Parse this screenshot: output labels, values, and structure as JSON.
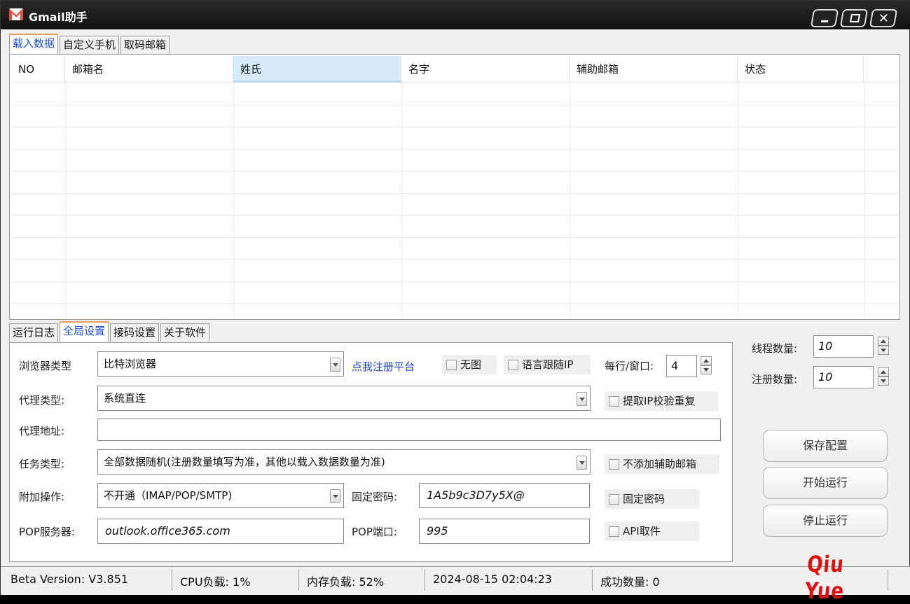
{
  "window": {
    "title": "Gmail助手",
    "accent": "#e74c3c"
  },
  "top_tabs": [
    {
      "label": "载入数据",
      "active": true
    },
    {
      "label": "自定义手机",
      "active": false
    },
    {
      "label": "取码邮箱",
      "active": false
    }
  ],
  "table": {
    "columns": [
      "NO",
      "邮箱名",
      "姓氏",
      "名字",
      "辅助邮箱",
      "状态"
    ],
    "selected_column": "姓氏",
    "rows": []
  },
  "bottom_tabs": [
    {
      "label": "运行日志",
      "active": false
    },
    {
      "label": "全局设置",
      "active": true
    },
    {
      "label": "接码设置",
      "active": false
    },
    {
      "label": "关于软件",
      "active": false
    }
  ],
  "settings": {
    "browser_label": "浏览器类型",
    "browser_value": "比特浏览器",
    "register_link": "点我注册平台",
    "no_image": "无图",
    "lang_follow_ip": "语言跟随IP",
    "per_row_label": "每行/窗口:",
    "per_row_value": "4",
    "proxy_type_label": "代理类型:",
    "proxy_type_value": "系统直连",
    "extract_ip_check": "提取IP校验重复",
    "proxy_addr_label": "代理地址:",
    "proxy_addr_value": "",
    "task_type_label": "任务类型:",
    "task_type_value": "全部数据随机(注册数量填写为准，其他以载入数据数量为准)",
    "no_aux_mail": "不添加辅助邮箱",
    "extra_op_label": "附加操作:",
    "extra_op_value": "不开通（IMAP/POP/SMTP)",
    "fixed_pwd_label": "固定密码:",
    "fixed_pwd_value": "1A5b9c3D7y5X@",
    "fixed_pwd_check": "固定密码",
    "pop_server_label": "POP服务器:",
    "pop_server_value": "outlook.office365.com",
    "pop_port_label": "POP端口:",
    "pop_port_value": "995",
    "api_fetch": "API取件"
  },
  "side": {
    "threads_label": "线程数量:",
    "threads_value": "10",
    "reg_count_label": "注册数量:",
    "reg_count_value": "10",
    "save_btn": "保存配置",
    "start_btn": "开始运行",
    "stop_btn": "停止运行"
  },
  "status": {
    "version": "Beta Version:  V3.851",
    "cpu": "CPU负载:  1%",
    "mem": "内存负载:  52%",
    "time": "2024-08-15 02:04:23",
    "success": "成功数量:  0"
  },
  "brand": "Qiu  Yue"
}
